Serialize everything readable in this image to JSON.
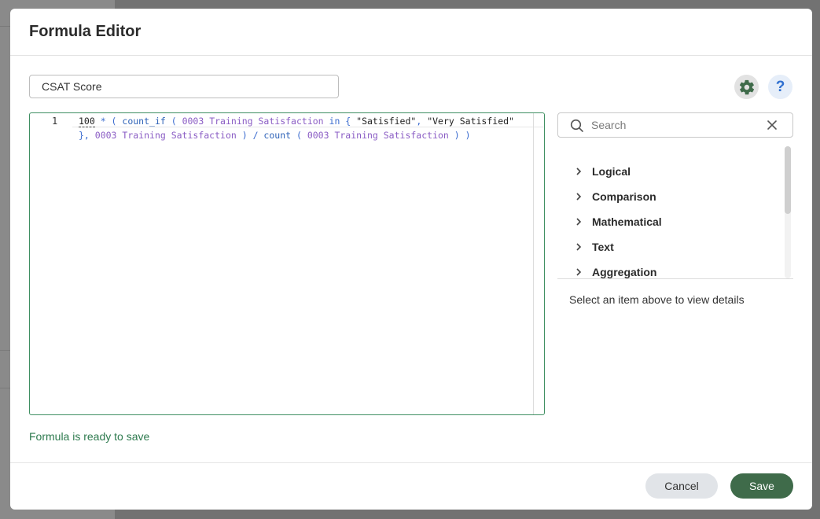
{
  "dialog": {
    "title": "Formula Editor"
  },
  "formula_name": {
    "value": "CSAT Score"
  },
  "toolbar": {
    "settings_icon": "gear-icon",
    "help_label": "?"
  },
  "editor": {
    "line_number": "1",
    "tokens": [
      {
        "type": "num",
        "text": "100"
      },
      {
        "type": "op",
        "text": " * ( "
      },
      {
        "type": "fn",
        "text": "count_if"
      },
      {
        "type": "op",
        "text": " ( "
      },
      {
        "type": "field",
        "text": "0003 Training Satisfaction"
      },
      {
        "type": "kw",
        "text": " in "
      },
      {
        "type": "op",
        "text": "{ "
      },
      {
        "type": "str",
        "text": "\"Satisfied\""
      },
      {
        "type": "op",
        "text": ", "
      },
      {
        "type": "str",
        "text": "\"Very Satisfied\""
      },
      {
        "type": "op",
        "text": " }, "
      },
      {
        "type": "field",
        "text": "0003 Training Satisfaction"
      },
      {
        "type": "op",
        "text": " ) / "
      },
      {
        "type": "fn",
        "text": "count"
      },
      {
        "type": "op",
        "text": " ( "
      },
      {
        "type": "field",
        "text": "0003 Training Satisfaction"
      },
      {
        "type": "op",
        "text": " ) )"
      }
    ]
  },
  "status_message": "Formula is ready to save",
  "search": {
    "placeholder": "Search",
    "value": ""
  },
  "categories": [
    {
      "label": "Logical"
    },
    {
      "label": "Comparison"
    },
    {
      "label": "Mathematical"
    },
    {
      "label": "Text"
    },
    {
      "label": "Aggregation"
    }
  ],
  "details_placeholder": "Select an item above to view details",
  "footer": {
    "cancel_label": "Cancel",
    "save_label": "Save"
  },
  "colors": {
    "accent_green": "#3f6b4a",
    "status_green": "#2d7a4e",
    "help_blue": "#2e6fd0"
  }
}
